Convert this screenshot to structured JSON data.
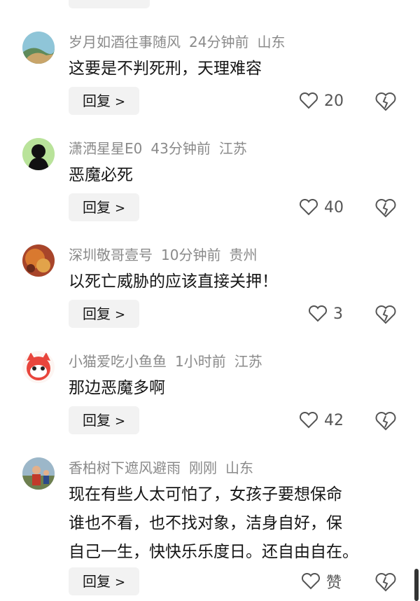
{
  "colors": {
    "meta": "#8a8a8a",
    "text": "#161616",
    "reply_bg": "#f2f2f2",
    "icon": "#555555"
  },
  "comments": [
    {
      "name": "岁月如酒往事随风",
      "time": "24分钟前",
      "location": "山东",
      "text": "这要是不判死刑，天理难容",
      "reply_label": "回复",
      "likes": "20"
    },
    {
      "name": "潇洒星星E0",
      "time": "43分钟前",
      "location": "江苏",
      "text": "恶魔必死",
      "reply_label": "回复",
      "likes": "40"
    },
    {
      "name": "深圳敬哥壹号",
      "time": "10分钟前",
      "location": "贵州",
      "text": "以死亡威胁的应该直接关押！",
      "reply_label": "回复",
      "likes": "3"
    },
    {
      "name": "小猫爱吃小鱼鱼",
      "time": "1小时前",
      "location": "江苏",
      "text": "那边恶魔多啊",
      "reply_label": "回复",
      "likes": "42"
    },
    {
      "name": "香柏树下遮风避雨",
      "time": "刚刚",
      "location": "山东",
      "text": "现在有些人太可怕了，女孩子要想保命\n谁也不看，也不找对象，洁身自好，保\n自己一生，快快乐乐度日。还自由自在。",
      "reply_label": "回复",
      "likes": "赞"
    }
  ]
}
